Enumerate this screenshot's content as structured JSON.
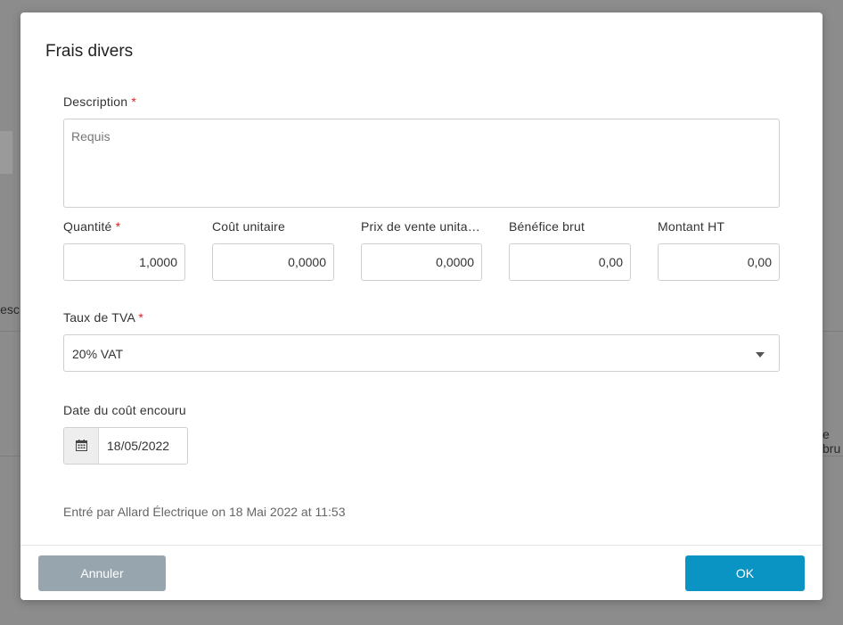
{
  "background": {
    "left_fragment": "Desc",
    "right_fragment": "e bru"
  },
  "dialog": {
    "title": "Frais divers",
    "description": {
      "label": "Description",
      "required_mark": "*",
      "placeholder": "Requis",
      "value": ""
    },
    "fields": {
      "quantity": {
        "label": "Quantité",
        "required_mark": "*",
        "value": "1,0000"
      },
      "unit_cost": {
        "label": "Coût unitaire",
        "value": "0,0000"
      },
      "unit_price": {
        "label": "Prix de vente unita…",
        "value": "0,0000"
      },
      "gross_profit": {
        "label": "Bénéfice brut",
        "value": "0,00"
      },
      "amount_ht": {
        "label": "Montant HT",
        "value": "0,00"
      }
    },
    "vat": {
      "label": "Taux de TVA",
      "required_mark": "*",
      "selected": "20% VAT"
    },
    "date": {
      "label": "Date du coût encouru",
      "value": "18/05/2022",
      "icon": "calendar-icon"
    },
    "entered_by": "Entré par Allard Électrique on 18 Mai 2022 at 11:53",
    "buttons": {
      "cancel": "Annuler",
      "ok": "OK"
    }
  },
  "colors": {
    "required": "#e02424",
    "ok_button": "#0a94c3",
    "cancel_button": "#97a5ae",
    "overlay": "#8c8c8c"
  }
}
